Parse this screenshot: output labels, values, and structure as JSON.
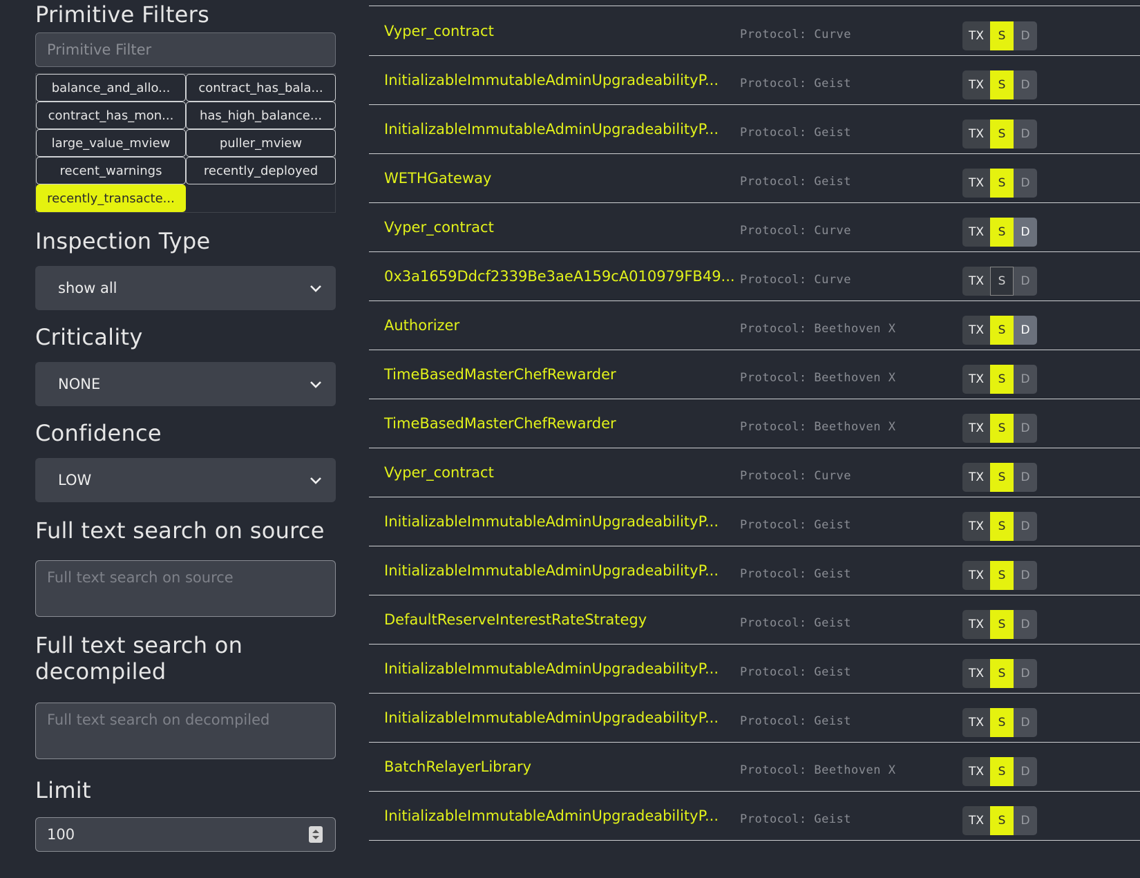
{
  "sidebar": {
    "primitive_filters": {
      "title": "Primitive Filters",
      "placeholder": "Primitive Filter",
      "chips": [
        {
          "label": "balance_and_allo...",
          "active": false
        },
        {
          "label": "contract_has_bala...",
          "active": false
        },
        {
          "label": "contract_has_mon...",
          "active": false
        },
        {
          "label": "has_high_balance...",
          "active": false
        },
        {
          "label": "large_value_mview",
          "active": false
        },
        {
          "label": "puller_mview",
          "active": false
        },
        {
          "label": "recent_warnings",
          "active": false
        },
        {
          "label": "recently_deployed",
          "active": false
        },
        {
          "label": "recently_transacte...",
          "active": true
        }
      ]
    },
    "inspection_type": {
      "title": "Inspection Type",
      "value": "show all"
    },
    "criticality": {
      "title": "Criticality",
      "value": "NONE"
    },
    "confidence": {
      "title": "Confidence",
      "value": "LOW"
    },
    "source_search": {
      "title": "Full text search on source",
      "placeholder": "Full text search on source"
    },
    "decompiled_search": {
      "title": "Full text search on decompiled",
      "placeholder": "Full text search on decompiled"
    },
    "limit": {
      "title": "Limit",
      "value": "100"
    }
  },
  "results": {
    "button_labels": {
      "tx": "TX",
      "s": "S",
      "d": "D"
    },
    "rows": [
      {
        "name": "Vyper_contract",
        "protocol": "Protocol: Curve",
        "s_on": true,
        "d_on": false
      },
      {
        "name": "InitializableImmutableAdminUpgradeabilityP...",
        "protocol": "Protocol: Geist",
        "s_on": true,
        "d_on": false
      },
      {
        "name": "InitializableImmutableAdminUpgradeabilityP...",
        "protocol": "Protocol: Geist",
        "s_on": true,
        "d_on": false
      },
      {
        "name": "WETHGateway",
        "protocol": "Protocol: Geist",
        "s_on": true,
        "d_on": false
      },
      {
        "name": "Vyper_contract",
        "protocol": "Protocol: Curve",
        "s_on": true,
        "d_on": true
      },
      {
        "name": "0x3a1659Ddcf2339Be3aeA159cA010979FB49...",
        "protocol": "Protocol: Curve",
        "s_on": false,
        "d_on": false
      },
      {
        "name": "Authorizer",
        "protocol": "Protocol: Beethoven X",
        "s_on": true,
        "d_on": true
      },
      {
        "name": "TimeBasedMasterChefRewarder",
        "protocol": "Protocol: Beethoven X",
        "s_on": true,
        "d_on": false
      },
      {
        "name": "TimeBasedMasterChefRewarder",
        "protocol": "Protocol: Beethoven X",
        "s_on": true,
        "d_on": false
      },
      {
        "name": "Vyper_contract",
        "protocol": "Protocol: Curve",
        "s_on": true,
        "d_on": false
      },
      {
        "name": "InitializableImmutableAdminUpgradeabilityP...",
        "protocol": "Protocol: Geist",
        "s_on": true,
        "d_on": false
      },
      {
        "name": "InitializableImmutableAdminUpgradeabilityP...",
        "protocol": "Protocol: Geist",
        "s_on": true,
        "d_on": false
      },
      {
        "name": "DefaultReserveInterestRateStrategy",
        "protocol": "Protocol: Geist",
        "s_on": true,
        "d_on": false
      },
      {
        "name": "InitializableImmutableAdminUpgradeabilityP...",
        "protocol": "Protocol: Geist",
        "s_on": true,
        "d_on": false
      },
      {
        "name": "InitializableImmutableAdminUpgradeabilityP...",
        "protocol": "Protocol: Geist",
        "s_on": true,
        "d_on": false
      },
      {
        "name": "BatchRelayerLibrary",
        "protocol": "Protocol: Beethoven X",
        "s_on": true,
        "d_on": false
      },
      {
        "name": "InitializableImmutableAdminUpgradeabilityP...",
        "protocol": "Protocol: Geist",
        "s_on": true,
        "d_on": false
      }
    ]
  }
}
